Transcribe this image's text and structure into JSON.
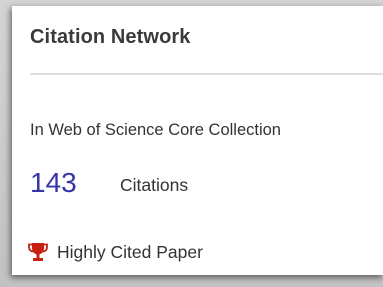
{
  "card": {
    "title": "Citation Network",
    "collection_label": "In Web of Science Core Collection",
    "citation_count": "143",
    "citation_label": "Citations",
    "highly_cited_label": "Highly Cited Paper"
  },
  "icons": {
    "trophy": "trophy-icon"
  },
  "colors": {
    "count": "#3535a8",
    "trophy": "#c8200e",
    "divider": "#dedede"
  }
}
